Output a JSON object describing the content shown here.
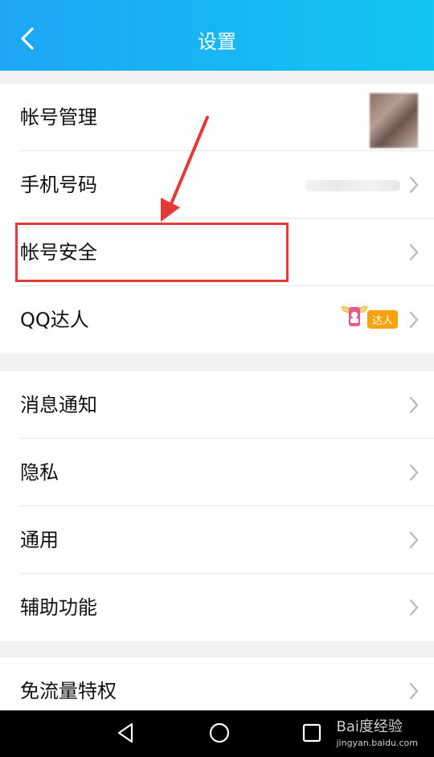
{
  "header": {
    "title": "设置",
    "back_icon": "chevron-left-icon"
  },
  "groups": [
    {
      "items": [
        {
          "label": "帐号管理",
          "right": "blurred-avatar"
        },
        {
          "label": "手机号码",
          "right": "blurred-phone"
        },
        {
          "label": "帐号安全",
          "right": "chevron"
        },
        {
          "label": "QQ达人",
          "right": "badge",
          "badge_text": "达人"
        }
      ]
    },
    {
      "items": [
        {
          "label": "消息通知"
        },
        {
          "label": "隐私"
        },
        {
          "label": "通用"
        },
        {
          "label": "辅助功能"
        }
      ]
    },
    {
      "items": [
        {
          "label": "免流量特权"
        }
      ]
    }
  ],
  "nav": {
    "back": "triangle-back-icon",
    "home": "circle-home-icon",
    "recent": "square-recent-icon"
  },
  "watermark": {
    "title": "Bai度经验",
    "sub": "jingyan.baidu.com"
  },
  "colors": {
    "header_start": "#1ea6f5",
    "header_end": "#12c5f3",
    "annotation": "#e53935",
    "badge": "#f7a20f"
  }
}
